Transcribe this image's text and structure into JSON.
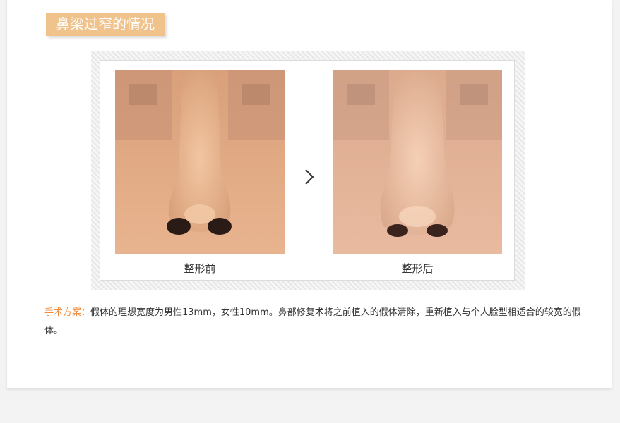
{
  "section": {
    "title": "鼻梁过窄的情况"
  },
  "comparison": {
    "before_label": "整形前",
    "after_label": "整形后",
    "arrow_icon": "chevron-right-icon"
  },
  "description": {
    "label": "手术方案：",
    "text": "假体的理想宽度为男性13mm，女性10mm。鼻部修复术将之前植入的假体清除，重新植入与个人脸型相适合的较宽的假体。"
  },
  "colors": {
    "title_bg": "#f0c38d",
    "label": "#f08a3c"
  }
}
